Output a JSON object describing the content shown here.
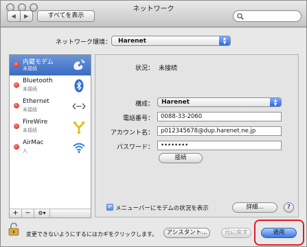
{
  "window": {
    "title": "ネットワーク"
  },
  "toolbar": {
    "back_label": "◀",
    "forward_label": "▶",
    "show_all_label": "すべてを表示",
    "search_placeholder": ""
  },
  "location": {
    "label": "ネットワーク環境：",
    "value": "Harenet"
  },
  "services": [
    {
      "name": "内蔵モデム",
      "status": "未接続",
      "icon": "phone-modem-icon",
      "selected": true
    },
    {
      "name": "Bluetooth",
      "status": "未接続",
      "icon": "bluetooth-icon",
      "selected": false
    },
    {
      "name": "Ethernet",
      "status": "未接続",
      "icon": "ethernet-icon",
      "selected": false
    },
    {
      "name": "FireWire",
      "status": "未接続",
      "icon": "firewire-icon",
      "selected": false
    },
    {
      "name": "AirMac",
      "status": "入",
      "icon": "airmac-wifi-icon",
      "selected": false
    }
  ],
  "sidebar_tools": {
    "add": "+",
    "remove": "−",
    "action": "⚙▾"
  },
  "detail": {
    "status_label": "状況：",
    "status_value": "未接続",
    "config_label": "構成：",
    "config_value": "Harenet",
    "phone_label": "電話番号：",
    "phone_value": "0088-33-2060",
    "account_label": "アカウント名：",
    "account_value": "p012345678@dup.harenet.ne.jp",
    "password_label": "パスワード：",
    "password_value": "••••••••",
    "connect_label": "接続",
    "menubar_checkbox_label": "メニューバーにモデムの状況を表示",
    "menubar_checked": true,
    "advanced_label": "詳細...",
    "help_label": "?"
  },
  "footer": {
    "lock_text": "変更できないようにするにはカギをクリックします。",
    "assistant_label": "アシスタント...",
    "revert_label": "元に戻す",
    "apply_label": "適用"
  },
  "colors": {
    "selection": "#3a6cc5",
    "status_dot": "#c81a0c",
    "highlight": "#e0191e",
    "default_button": "#3977e3"
  }
}
